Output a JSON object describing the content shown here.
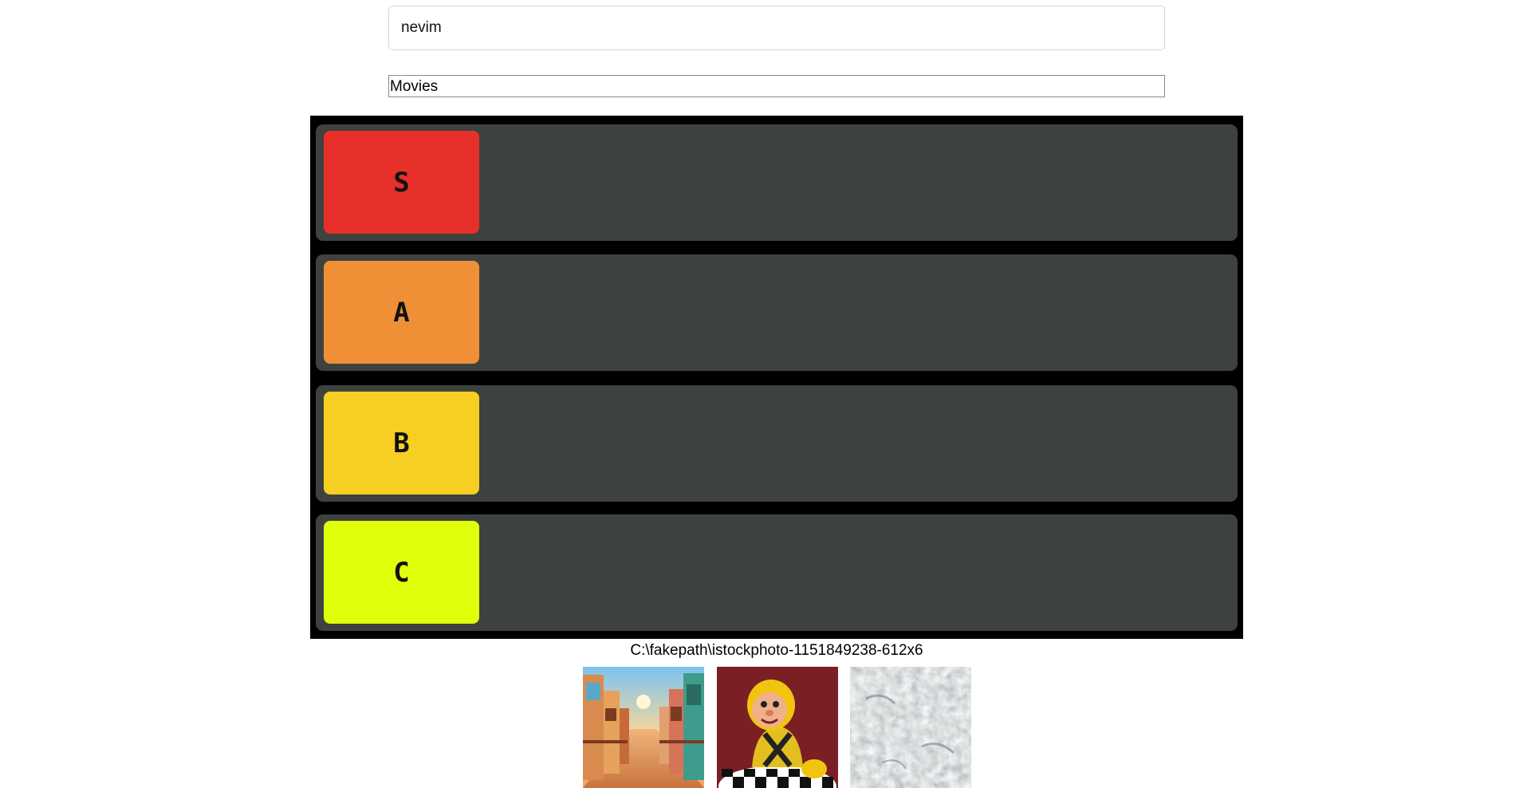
{
  "title_input": {
    "value": "nevim"
  },
  "category_select": {
    "selected": "Movies"
  },
  "tiers": [
    {
      "label": "S",
      "color": "#e8302a"
    },
    {
      "label": "A",
      "color": "#f09036"
    },
    {
      "label": "B",
      "color": "#f7cf22"
    },
    {
      "label": "C",
      "color": "#dfff0b"
    }
  ],
  "file_input": {
    "filename": "C:\\fakepath\\istockphoto-1151849238-612x6"
  },
  "images": [
    {
      "name": "western-town-image"
    },
    {
      "name": "cartoon-character-image"
    },
    {
      "name": "stone-texture-image"
    }
  ]
}
